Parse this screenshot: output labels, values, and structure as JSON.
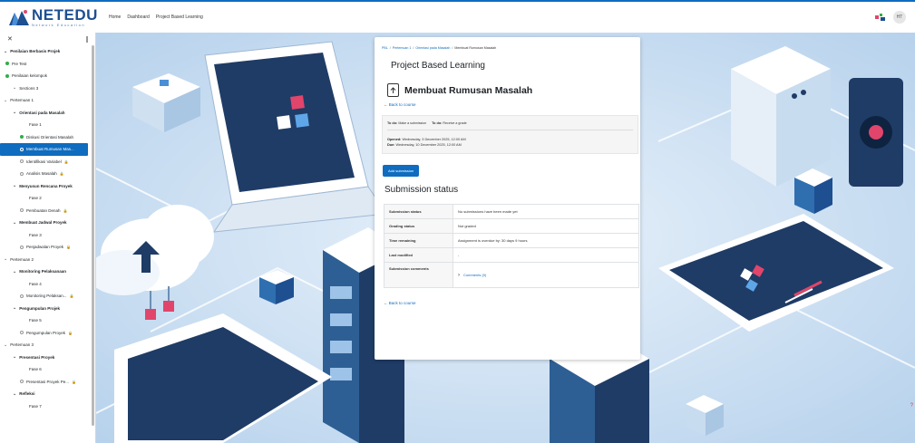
{
  "navbar": {
    "brand": "NETEDU",
    "brand_sub": "Network Education",
    "links": [
      "Home",
      "Dashboard",
      "Project Based Learning"
    ],
    "user_initials": "HT"
  },
  "drawer": {
    "items": [
      {
        "label": "Penilaian Berbasis Projek",
        "kind": "chevron",
        "indent": 4,
        "bold": true
      },
      {
        "label": "Pre Test",
        "kind": "dot",
        "indent": 6
      },
      {
        "label": "Penilaian kelompok",
        "kind": "dot",
        "indent": 6
      },
      {
        "label": "Sections 3",
        "kind": "chevron",
        "indent": 14
      },
      {
        "label": "Pertemuan 1",
        "kind": "chevron",
        "indent": 4
      },
      {
        "label": "Orientasi pada Masalah",
        "kind": "chevron",
        "indent": 14,
        "bold": true
      },
      {
        "label": "Fase 1",
        "kind": "none",
        "indent": 32
      },
      {
        "label": "Diskusi Orientasi Masalah",
        "kind": "dot",
        "indent": 22
      },
      {
        "label": "Membuat Rumusan Mas...",
        "kind": "ring",
        "indent": 22,
        "active": true
      },
      {
        "label": "Identifikasi Variabel",
        "kind": "ring",
        "indent": 22,
        "lock": true
      },
      {
        "label": "Analisis Masalah",
        "kind": "ring",
        "indent": 22,
        "lock": true
      },
      {
        "label": "Menyusun Rencana Proyek",
        "kind": "chevron",
        "indent": 14,
        "bold": true
      },
      {
        "label": "Fase 2",
        "kind": "none",
        "indent": 32
      },
      {
        "label": "Pembuatan Denah",
        "kind": "ring",
        "indent": 22,
        "lock": true
      },
      {
        "label": "Membuat Jadwal Proyek",
        "kind": "chevron",
        "indent": 14,
        "bold": true
      },
      {
        "label": "Fase 3",
        "kind": "none",
        "indent": 32
      },
      {
        "label": "Penjadwalan Proyek",
        "kind": "ring",
        "indent": 22,
        "lock": true
      },
      {
        "label": "Pertemuan 2",
        "kind": "chevron",
        "indent": 4
      },
      {
        "label": "Monitoring Pelaksanaan",
        "kind": "chevron",
        "indent": 14,
        "bold": true
      },
      {
        "label": "Fase 4",
        "kind": "none",
        "indent": 32
      },
      {
        "label": "Monitoring Pelaksan...",
        "kind": "ring",
        "indent": 22,
        "lock": true
      },
      {
        "label": "Pengumpulan Projek",
        "kind": "chevron",
        "indent": 14,
        "bold": true
      },
      {
        "label": "Fase 5",
        "kind": "none",
        "indent": 32
      },
      {
        "label": "Pengumpulan Proyek",
        "kind": "ring",
        "indent": 22,
        "lock": true
      },
      {
        "label": "Pertemuan 3",
        "kind": "chevron",
        "indent": 4
      },
      {
        "label": "Presentasi Proyek",
        "kind": "chevron",
        "indent": 14,
        "bold": true
      },
      {
        "label": "Fase 6",
        "kind": "none",
        "indent": 32
      },
      {
        "label": "Presentasi Proyek Pe...",
        "kind": "ring",
        "indent": 22,
        "lock": true
      },
      {
        "label": "Refleksi",
        "kind": "chevron",
        "indent": 14,
        "bold": true
      },
      {
        "label": "Fase 7",
        "kind": "none",
        "indent": 32
      }
    ]
  },
  "card": {
    "breadcrumb": {
      "items": [
        "PBL",
        "Pertemuan 1",
        "Orientasi pada Masalah"
      ],
      "current": "Membuat Rumusan Masalah"
    },
    "course_title": "Project Based Learning",
    "activity_title": "Membuat Rumusan Masalah",
    "back_to_course": "Back to course",
    "todo1_label": "To do:",
    "todo1_value": "Make a submission",
    "todo2_label": "To do:",
    "todo2_value": "Receive a grade",
    "opened_label": "Opened:",
    "opened_value": "Wednesday, 3 December 2025, 12:00 AM",
    "due_label": "Due:",
    "due_value": "Wednesday, 10 December 2025, 12:00 AM",
    "add_submission": "Add submission",
    "submission_status_title": "Submission status",
    "status_rows": [
      {
        "key": "Submission status",
        "value": "No submissions have been made yet"
      },
      {
        "key": "Grading status",
        "value": "Not graded"
      },
      {
        "key": "Time remaining",
        "value": "Assignment is overdue by: 30 days 9 hours"
      },
      {
        "key": "Last modified",
        "value": "-"
      },
      {
        "key": "Submission comments",
        "value": "Comments (0)"
      }
    ],
    "back_to_course_bottom": "Back to course"
  },
  "colors": {
    "primary": "#0f6cbf",
    "overdue": "#c93424",
    "done_dot": "#2fae4a",
    "scene_bg": "#d6e6f5"
  }
}
